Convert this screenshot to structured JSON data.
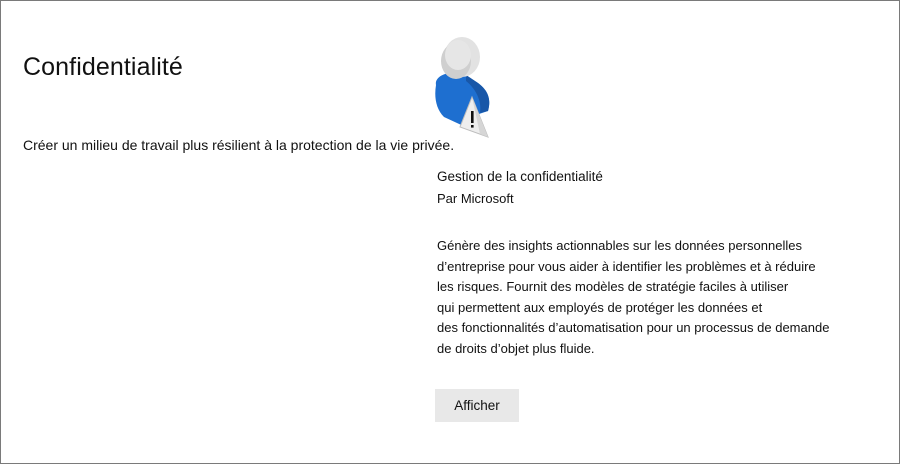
{
  "header": {
    "title": "Confidentialité",
    "subtitle": "Créer un milieu de travail plus résilient à la protection de la vie privée."
  },
  "illustration": {
    "icon": "person-warning-icon",
    "colors": {
      "head": "#d9d9d9",
      "body_blue": "#1e6fd0",
      "body_dark": "#1857a8",
      "warning": "#ececec"
    }
  },
  "card": {
    "product_name": "Gestion de la confidentialité",
    "publisher": "Par Microsoft",
    "description_lines": [
      "Génère des insights actionnables sur les données personnelles",
      "d’entreprise pour vous aider à identifier les problèmes et à réduire",
      "les risques. Fournit des modèles de stratégie faciles à utiliser",
      "qui permettent aux employés de protéger les données et",
      "des fonctionnalités d’automatisation pour un processus de demande",
      "de droits d’objet plus fluide."
    ],
    "button_label": "Afficher"
  }
}
